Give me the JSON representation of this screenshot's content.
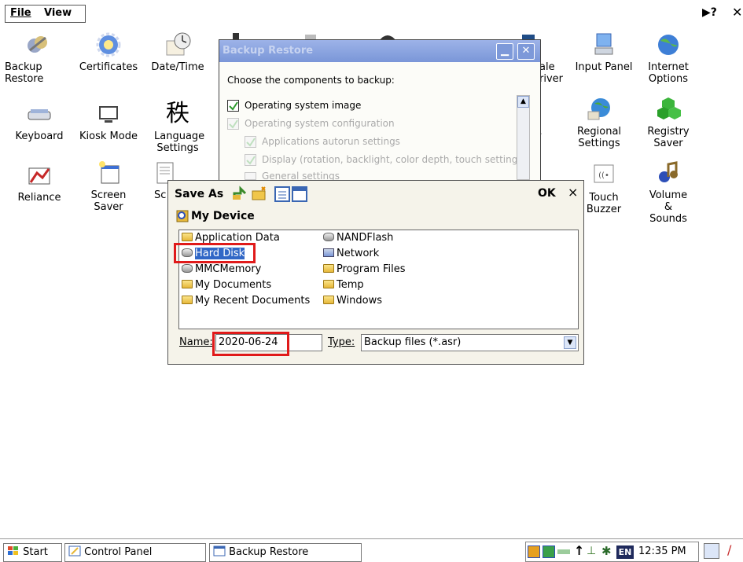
{
  "menu": {
    "file": "File",
    "view": "View",
    "help_icon": "help-question-icon",
    "close_icon": "close-icon"
  },
  "desktop_icons": [
    {
      "label": "Backup Restore",
      "icon": "backup-restore-icon"
    },
    {
      "label": "Certificates",
      "icon": "certificates-icon"
    },
    {
      "label": "Date/Time",
      "icon": "clock-icon"
    },
    {
      "label": "Keyboard",
      "icon": "keyboard-icon"
    },
    {
      "label": "Kiosk Mode",
      "icon": "monitor-icon"
    },
    {
      "label": "Language Settings",
      "icon": "language-glyph-icon"
    },
    {
      "label": "Reliance",
      "icon": "reliance-icon"
    },
    {
      "label": "Screen Saver",
      "icon": "screen-saver-icon"
    },
    {
      "label": "Sc",
      "icon": "document-icon"
    },
    {
      "label": "ale river",
      "icon": "driver-icon"
    },
    {
      "label": "Input Panel",
      "icon": "input-panel-icon"
    },
    {
      "label": "Internet Options",
      "icon": "internet-options-icon"
    },
    {
      "label": "r",
      "icon": "partial-icon"
    },
    {
      "label": "Regional Settings",
      "icon": "globe-icon"
    },
    {
      "label": "Registry Saver",
      "icon": "registry-icon"
    },
    {
      "label": "Touch Buzzer",
      "icon": "buzzer-icon"
    },
    {
      "label": "Volume & Sounds",
      "icon": "speaker-icon"
    }
  ],
  "backup_dialog": {
    "title": "Backup Restore",
    "prompt": "Choose the components to backup:",
    "options": [
      {
        "label": "Operating system image",
        "checked": true,
        "enabled": true
      },
      {
        "label": "Operating system configuration",
        "checked": true,
        "enabled": false
      },
      {
        "label": "Applications autorun settings",
        "checked": true,
        "enabled": false
      },
      {
        "label": "Display (rotation, backlight, color depth, touch settings)",
        "checked": true,
        "enabled": false
      },
      {
        "label": "General settings",
        "checked": true,
        "enabled": false
      }
    ]
  },
  "save_as": {
    "title": "Save As",
    "ok": "OK",
    "close": "×",
    "location": "My Device",
    "files_col1": [
      "Application Data",
      "Hard Disk",
      "MMCMemory",
      "My Documents",
      "My Recent Documents"
    ],
    "files_col1_icons": [
      "folder",
      "drive",
      "drive",
      "folder",
      "folder"
    ],
    "files_col2": [
      "NANDFlash",
      "Network",
      "Program Files",
      "Temp",
      "Windows"
    ],
    "files_col2_icons": [
      "drive",
      "network",
      "folder",
      "folder",
      "folder"
    ],
    "selected": "Hard Disk",
    "name_label": "Name:",
    "name_value": "2020-06-24",
    "type_label": "Type:",
    "type_value": "Backup files (*.asr)"
  },
  "taskbar": {
    "start": "Start",
    "control_panel": "Control Panel",
    "backup_restore": "Backup Restore",
    "lang": "EN",
    "time": "12:35 PM"
  },
  "colors": {
    "selection": "#3167c6",
    "highlight_box": "#e01a1a",
    "title_inactive": "#8ea5e0"
  }
}
